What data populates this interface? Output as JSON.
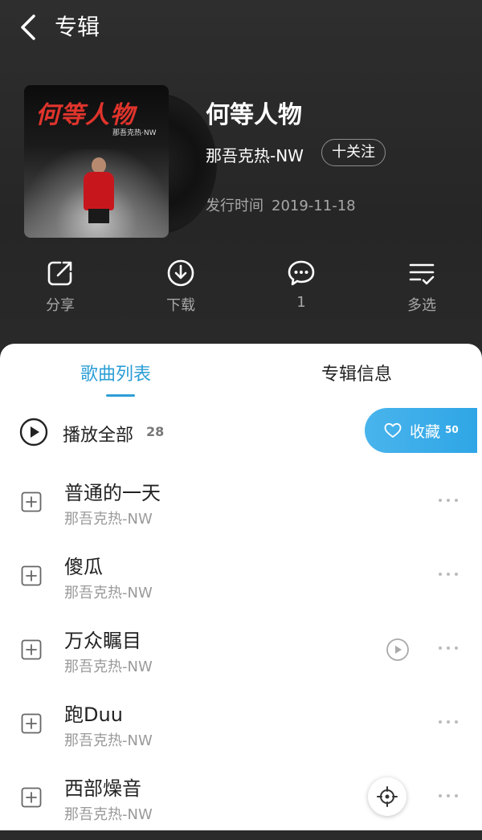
{
  "header": {
    "title": "专辑"
  },
  "album": {
    "cover_title": "何等人物",
    "cover_subtitle": "那吾克热·NW",
    "title": "何等人物",
    "artist": "那吾克热-NW",
    "follow_label": "十关注",
    "release_label": "发行时间",
    "release_date": "2019-11-18"
  },
  "actions": [
    {
      "label": "分享",
      "icon": "share-icon"
    },
    {
      "label": "下载",
      "icon": "download-icon"
    },
    {
      "label": "1",
      "icon": "comment-icon"
    },
    {
      "label": "多选",
      "icon": "multi-select-icon"
    }
  ],
  "tabs": {
    "songs": "歌曲列表",
    "info": "专辑信息"
  },
  "playall": {
    "label": "播放全部",
    "count": "28"
  },
  "collect": {
    "label": "收藏",
    "count": "50"
  },
  "songs": [
    {
      "title": "普通的一天",
      "artist": "那吾克热-NW",
      "has_mv": false
    },
    {
      "title": "傻瓜",
      "artist": "那吾克热-NW",
      "has_mv": false
    },
    {
      "title": "万众瞩目",
      "artist": "那吾克热-NW",
      "has_mv": true
    },
    {
      "title": "跑Duu",
      "artist": "那吾克热-NW",
      "has_mv": false
    },
    {
      "title": "西部燥音",
      "artist": "那吾克热-NW",
      "has_mv": false
    }
  ],
  "colors": {
    "accent": "#2c9ed6",
    "header_bg": "#2b2b2b",
    "muted_text": "#a7a7a7"
  }
}
